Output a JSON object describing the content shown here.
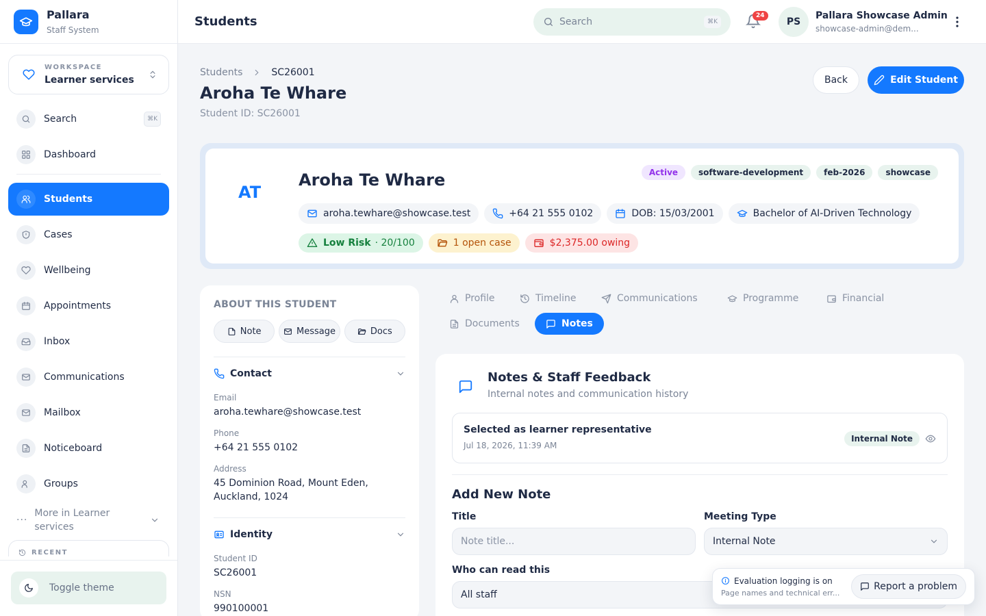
{
  "brand": {
    "name": "Pallara",
    "sub": "Staff System"
  },
  "workspace": {
    "label": "WORKSPACE",
    "name": "Learner services"
  },
  "sidebar": {
    "search_label": "Search",
    "search_shortcut": "⌘K",
    "items": [
      {
        "label": "Dashboard",
        "icon": "grid-icon"
      },
      {
        "label": "Students",
        "icon": "users-icon",
        "active": true
      },
      {
        "label": "Cases",
        "icon": "shield-icon"
      },
      {
        "label": "Wellbeing",
        "icon": "heart-icon"
      },
      {
        "label": "Appointments",
        "icon": "calendar-icon"
      },
      {
        "label": "Inbox",
        "icon": "inbox-icon"
      },
      {
        "label": "Communications",
        "icon": "mail-icon"
      },
      {
        "label": "Mailbox",
        "icon": "mail-icon"
      },
      {
        "label": "Noticeboard",
        "icon": "file-icon"
      },
      {
        "label": "Groups",
        "icon": "users-icon"
      }
    ],
    "more_label": "More in Learner services",
    "recent_label": "RECENT",
    "toggle_theme": "Toggle theme"
  },
  "topbar": {
    "title": "Students",
    "search_placeholder": "Search",
    "search_shortcut": "⌘K",
    "notification_count": "24",
    "user_initials": "PS",
    "user_name": "Pallara Showcase Admin",
    "user_email": "showcase-admin@dem..."
  },
  "page": {
    "breadcrumb_root": "Students",
    "breadcrumb_current": "SC26001",
    "title": "Aroha Te Whare",
    "subtitle": "Student ID: SC26001",
    "back_label": "Back",
    "edit_label": "Edit Student"
  },
  "student": {
    "initials": "AT",
    "name": "Aroha Te Whare",
    "tags": [
      "Active",
      "software-development",
      "feb-2026",
      "showcase"
    ],
    "email": "aroha.tewhare@showcase.test",
    "phone": "+64 21 555 0102",
    "dob": "DOB: 15/03/2001",
    "programme": "Bachelor of AI-Driven Technology",
    "risk_label": "Low Risk",
    "risk_score": "· 20/100",
    "open_cases": "1 open case",
    "owing": "$2,375.00 owing"
  },
  "about": {
    "heading": "ABOUT THIS STUDENT",
    "buttons": [
      "Note",
      "Message",
      "Docs"
    ],
    "contact": {
      "heading": "Contact",
      "email_label": "Email",
      "email": "aroha.tewhare@showcase.test",
      "phone_label": "Phone",
      "phone": "+64 21 555 0102",
      "address_label": "Address",
      "address_line1": "45 Dominion Road, Mount Eden,",
      "address_line2": "Auckland, 1024"
    },
    "identity": {
      "heading": "Identity",
      "student_id_label": "Student ID",
      "student_id": "SC26001",
      "nsn_label": "NSN",
      "nsn": "990100001"
    }
  },
  "tabs": [
    "Profile",
    "Timeline",
    "Communications",
    "Programme",
    "Financial",
    "Documents",
    "Notes"
  ],
  "active_tab": "Notes",
  "notes": {
    "title": "Notes & Staff Feedback",
    "subtitle": "Internal notes and communication history",
    "items": [
      {
        "title": "Selected as learner representative",
        "date": "Jul 18, 2026, 11:39 AM",
        "badge": "Internal Note"
      }
    ],
    "add_heading": "Add New Note",
    "title_label": "Title",
    "title_placeholder": "Note title...",
    "meeting_label": "Meeting Type",
    "meeting_value": "Internal Note",
    "visibility_label": "Who can read this",
    "visibility_value": "All staff"
  },
  "toast": {
    "title": "Evaluation logging is on",
    "sub": "Page names and technical err...",
    "button": "Report a problem"
  },
  "colors": {
    "accent": "#1479ff",
    "mint": "#e8f3ee",
    "risk_green": "#15803d",
    "amber": "#b45309",
    "red": "#dc2626"
  }
}
